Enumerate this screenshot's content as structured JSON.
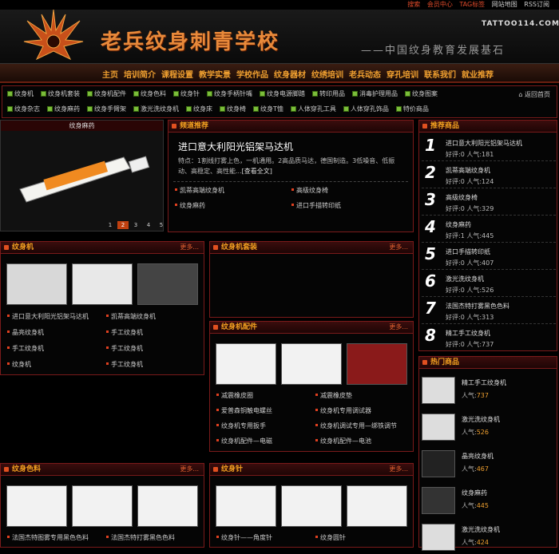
{
  "topbar": {
    "items": [
      "搜索",
      "会员中心",
      "TAG标签",
      "网站地图",
      "RSS订阅"
    ]
  },
  "header": {
    "title": "老兵纹身刺青学校",
    "domain": "TATTOO114.COM",
    "slogan": "——中国纹身教育发展基石"
  },
  "nav": [
    "主页",
    "培训简介",
    "课程设置",
    "教学实景",
    "学校作品",
    "纹身器材",
    "纹绣培训",
    "老兵动态",
    "穿孔培训",
    "联系我们",
    "就业推荐"
  ],
  "categories": {
    "row1": [
      "纹身机",
      "纹身机套装",
      "纹身机配件",
      "纹身色料",
      "纹身针",
      "纹身手柄针嘴",
      "纹身电源脚踏",
      "转印用品",
      "消毒护理用品",
      "纹身图案"
    ],
    "row2": [
      "纹身杂志",
      "纹身麻药",
      "纹身手臂架",
      "激光洗纹身机",
      "纹身床",
      "纹身椅",
      "纹身T恤",
      "人体穿孔工具",
      "人体穿孔饰品",
      "特价商品"
    ],
    "home": "返回首页"
  },
  "slide": {
    "title": "纹身麻药",
    "pages": [
      "1",
      "2",
      "3",
      "4",
      "5"
    ]
  },
  "featured": {
    "head": "频道推荐",
    "title": "进口意大利阳光铝架马达机",
    "desc": "特点：1割线打雾上色，一机通用。2高品质马达，德国制造。3低噪音、低振动、高稳定、高性能...",
    "more": "[查看全文]",
    "links": [
      "凯蒂高端纹身机",
      "高级纹身椅",
      "纹身麻药",
      "进口手描转印纸"
    ]
  },
  "recommend": {
    "head": "推荐商品",
    "items": [
      {
        "no": "1",
        "name": "进口意大利阳光铝架马达机",
        "stat": "好评:0 人气:181"
      },
      {
        "no": "2",
        "name": "凯蒂高端纹身机",
        "stat": "好评:0 人气:124"
      },
      {
        "no": "3",
        "name": "高级纹身椅",
        "stat": "好评:0 人气:329"
      },
      {
        "no": "4",
        "name": "纹身麻药",
        "stat": "好评:1 人气:445"
      },
      {
        "no": "5",
        "name": "进口手描转印纸",
        "stat": "好评:0 人气:407"
      },
      {
        "no": "6",
        "name": "激光洗纹身机",
        "stat": "好评:0 人气:526"
      },
      {
        "no": "7",
        "name": "法国杰特打雾黑色色料",
        "stat": "好评:0 人气:313"
      },
      {
        "no": "8",
        "name": "精工手工纹身机",
        "stat": "好评:0 人气:737"
      }
    ]
  },
  "hot": {
    "head": "热门商品",
    "items": [
      {
        "name": "精工手工纹身机",
        "label": "人气:",
        "pop": "737"
      },
      {
        "name": "激光洗纹身机",
        "label": "人气:",
        "pop": "526"
      },
      {
        "name": "晶亮纹身机",
        "label": "人气:",
        "pop": "467"
      },
      {
        "name": "纹身麻药",
        "label": "人气:",
        "pop": "445"
      },
      {
        "name": "激光洗纹身机",
        "label": "人气:",
        "pop": "424"
      }
    ]
  },
  "machine": {
    "head": "纹身机",
    "more": "更多...",
    "links": [
      "进口意大利阳光铝架马达机",
      "凯蒂高端纹身机",
      "晶亮纹身机",
      "手工纹身机",
      "手工纹身机",
      "手工纹身机",
      "纹身机",
      "手工纹身机"
    ]
  },
  "kit": {
    "head": "纹身机套装",
    "more": "更多..."
  },
  "parts": {
    "head": "纹身机配件",
    "more": "更多...",
    "links": [
      "减震橡皮圈",
      "减震橡皮垫",
      "爱普森铜触电螺丝",
      "纹身机专用调试器",
      "纹身机专用扳手",
      "纹身机调试专用—绑铁调节",
      "纹身机配件—电磁",
      "纹身机配件—电池"
    ]
  },
  "ink": {
    "head": "纹身色料",
    "more": "更多...",
    "links": [
      "法国杰特图雾专用黑色色料",
      "法国杰特打雾黑色色料"
    ]
  },
  "needle": {
    "head": "纹身针",
    "more": "更多...",
    "links": [
      "纹身针——角度针",
      "纹身圆针"
    ]
  }
}
